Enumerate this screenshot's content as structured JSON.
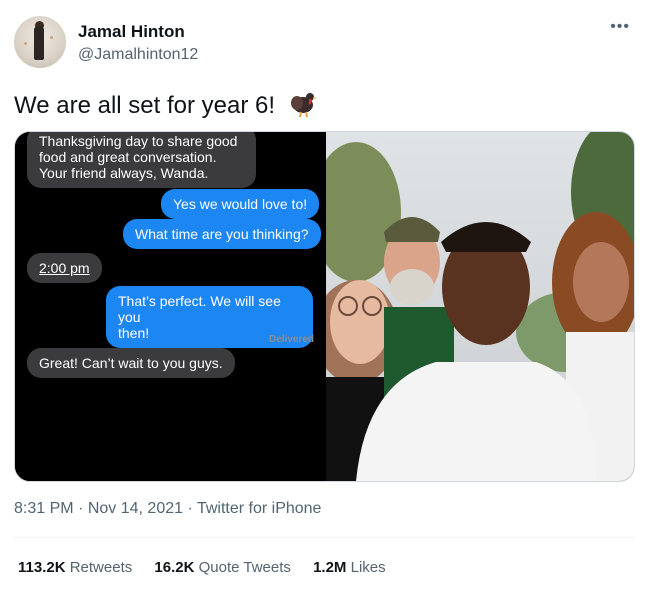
{
  "author": {
    "name": "Jamal Hinton",
    "handle": "@Jamalhinton12"
  },
  "more_icon": "more-horizontal-icon",
  "tweet": {
    "text": "We are all set for year 6!",
    "emoji": "turkey"
  },
  "messages": [
    {
      "side": "in",
      "text_lines": [
        "Thanksgiving day to share good",
        "food and great conversation.",
        "Your friend always, Wanda."
      ]
    },
    {
      "side": "out",
      "text_lines": [
        "Yes we would love to!"
      ]
    },
    {
      "side": "out",
      "text_lines": [
        "What time are you thinking?"
      ]
    },
    {
      "side": "in",
      "text_lines": [
        "2:00 pm"
      ]
    },
    {
      "side": "out",
      "text_lines": [
        "That’s perfect. We will see you",
        "then!"
      ]
    },
    {
      "side": "in",
      "text_lines": [
        "Great! Can’t wait to you guys."
      ]
    }
  ],
  "delivered": "Delivered",
  "meta": {
    "time": "8:31 PM",
    "date": "Nov 14, 2021",
    "source": "Twitter for iPhone"
  },
  "stats": {
    "retweets_count": "113.2K",
    "retweets_label": "Retweets",
    "quote_count": "16.2K",
    "quote_label": "Quote Tweets",
    "likes_count": "1.2M",
    "likes_label": "Likes"
  },
  "colors": {
    "imessage_blue": "#1c86f2",
    "imessage_gray": "#3b3b3d",
    "secondary_text": "#536471"
  }
}
